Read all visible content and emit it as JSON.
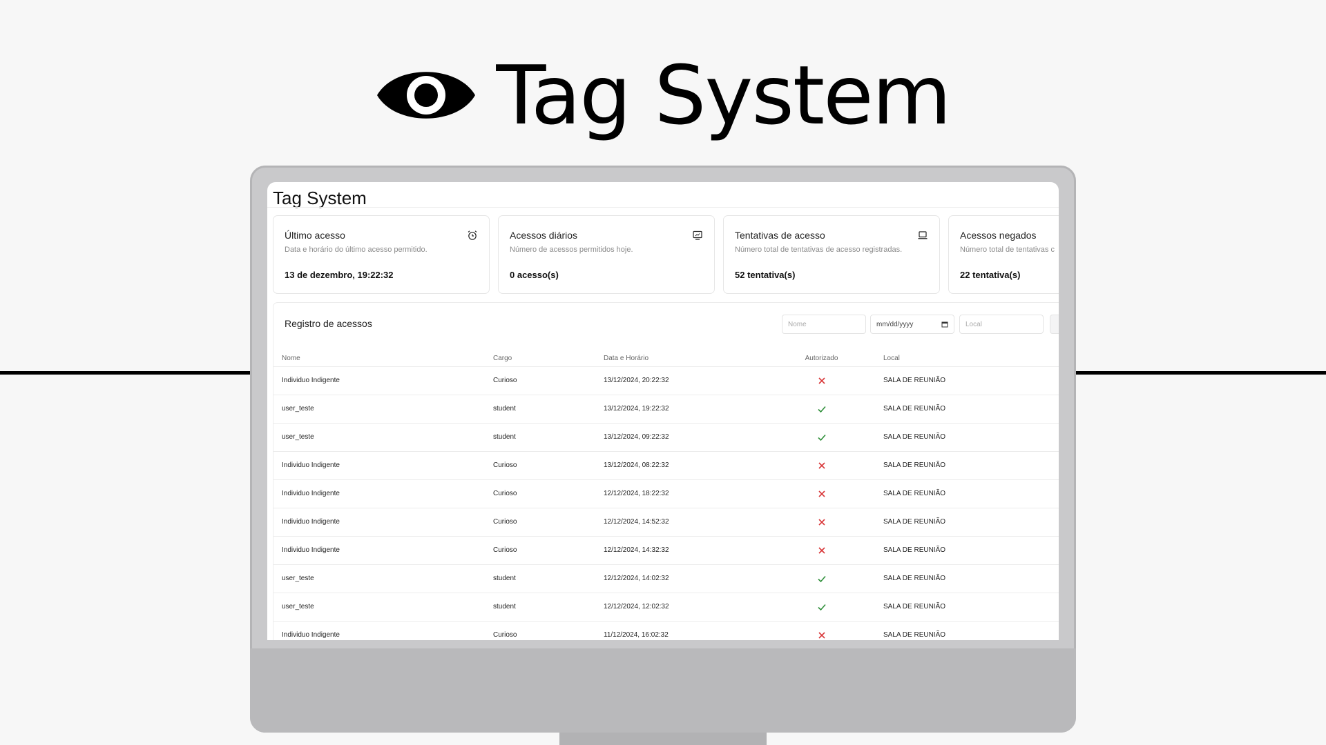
{
  "brand": {
    "title": "Tag System",
    "icon": "eye-icon"
  },
  "app": {
    "title": "Tag System"
  },
  "cards": [
    {
      "title": "Último acesso",
      "description": "Data e horário do último acesso permitido.",
      "value": "13 de dezembro, 19:22:32",
      "icon": "alarm-clock-icon"
    },
    {
      "title": "Acessos diários",
      "description": "Número de acessos permitidos hoje.",
      "value": "0 acesso(s)",
      "icon": "tablet-icon"
    },
    {
      "title": "Tentativas de acesso",
      "description": "Número total de tentativas de acesso registradas.",
      "value": "52 tentativa(s)",
      "icon": "laptop-icon"
    },
    {
      "title": "Acessos negados",
      "description": "Número total de tentativas c",
      "value": "22 tentativa(s)",
      "icon": ""
    }
  ],
  "log": {
    "title": "Registro de acessos",
    "filters": {
      "name_placeholder": "Nome",
      "date_placeholder": "mm/dd/yyyy",
      "local_placeholder": "Local"
    },
    "columns": {
      "name": "Nome",
      "role": "Cargo",
      "datetime": "Data e Horário",
      "authorized": "Autorizado",
      "local": "Local"
    },
    "rows": [
      {
        "name": "Individuo Indigente",
        "role": "Curioso",
        "datetime": "13/12/2024, 20:22:32",
        "authorized": false,
        "local": "SALA DE REUNIÃO"
      },
      {
        "name": "user_teste",
        "role": "student",
        "datetime": "13/12/2024, 19:22:32",
        "authorized": true,
        "local": "SALA DE REUNIÃO"
      },
      {
        "name": "user_teste",
        "role": "student",
        "datetime": "13/12/2024, 09:22:32",
        "authorized": true,
        "local": "SALA DE REUNIÃO"
      },
      {
        "name": "Individuo Indigente",
        "role": "Curioso",
        "datetime": "13/12/2024, 08:22:32",
        "authorized": false,
        "local": "SALA DE REUNIÃO"
      },
      {
        "name": "Individuo Indigente",
        "role": "Curioso",
        "datetime": "12/12/2024, 18:22:32",
        "authorized": false,
        "local": "SALA DE REUNIÃO"
      },
      {
        "name": "Individuo Indigente",
        "role": "Curioso",
        "datetime": "12/12/2024, 14:52:32",
        "authorized": false,
        "local": "SALA DE REUNIÃO"
      },
      {
        "name": "Individuo Indigente",
        "role": "Curioso",
        "datetime": "12/12/2024, 14:32:32",
        "authorized": false,
        "local": "SALA DE REUNIÃO"
      },
      {
        "name": "user_teste",
        "role": "student",
        "datetime": "12/12/2024, 14:02:32",
        "authorized": true,
        "local": "SALA DE REUNIÃO"
      },
      {
        "name": "user_teste",
        "role": "student",
        "datetime": "12/12/2024, 12:02:32",
        "authorized": true,
        "local": "SALA DE REUNIÃO"
      },
      {
        "name": "Individuo Indigente",
        "role": "Curioso",
        "datetime": "11/12/2024, 16:02:32",
        "authorized": false,
        "local": "SALA DE REUNIÃO"
      }
    ]
  },
  "colors": {
    "authorized": "#2f8f3a",
    "denied": "#d9383a",
    "border": "#e6e6e6"
  }
}
